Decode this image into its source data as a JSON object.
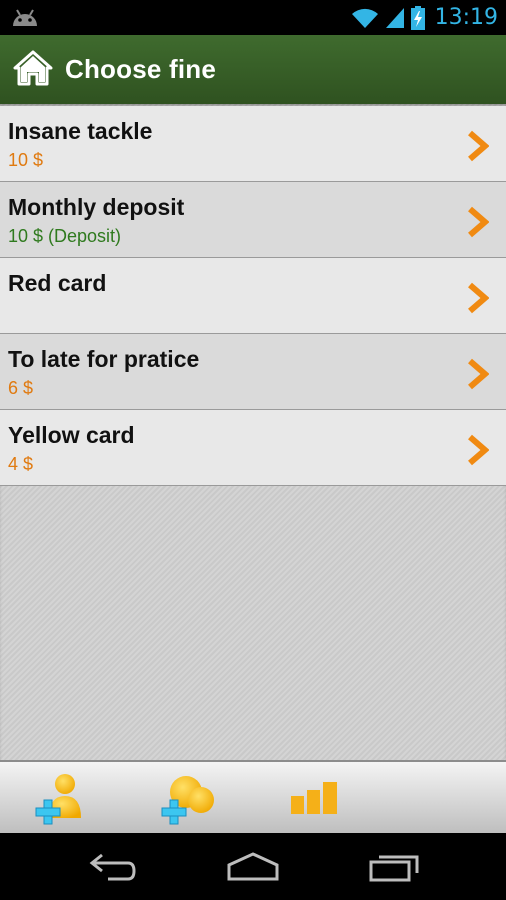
{
  "status_bar": {
    "time": "13:19"
  },
  "action_bar": {
    "title": "Choose fine"
  },
  "fines": [
    {
      "name": "Insane tackle",
      "amount": "10 $",
      "style": "orange"
    },
    {
      "name": "Monthly deposit",
      "amount": "10 $ (Deposit)",
      "style": "green"
    },
    {
      "name": "Red card",
      "amount": "",
      "style": "orange"
    },
    {
      "name": "To late for pratice",
      "amount": "6 $",
      "style": "orange"
    },
    {
      "name": "Yellow card",
      "amount": "4 $",
      "style": "orange"
    }
  ],
  "toolbar": {
    "buttons": [
      "add-person-icon",
      "add-group-icon",
      "statistics-icon"
    ]
  },
  "colors": {
    "accent_orange": "#e07a10",
    "deposit_green": "#2f7a1e",
    "actionbar_green": "#3f6b2e",
    "clock_blue": "#33b5e5"
  }
}
